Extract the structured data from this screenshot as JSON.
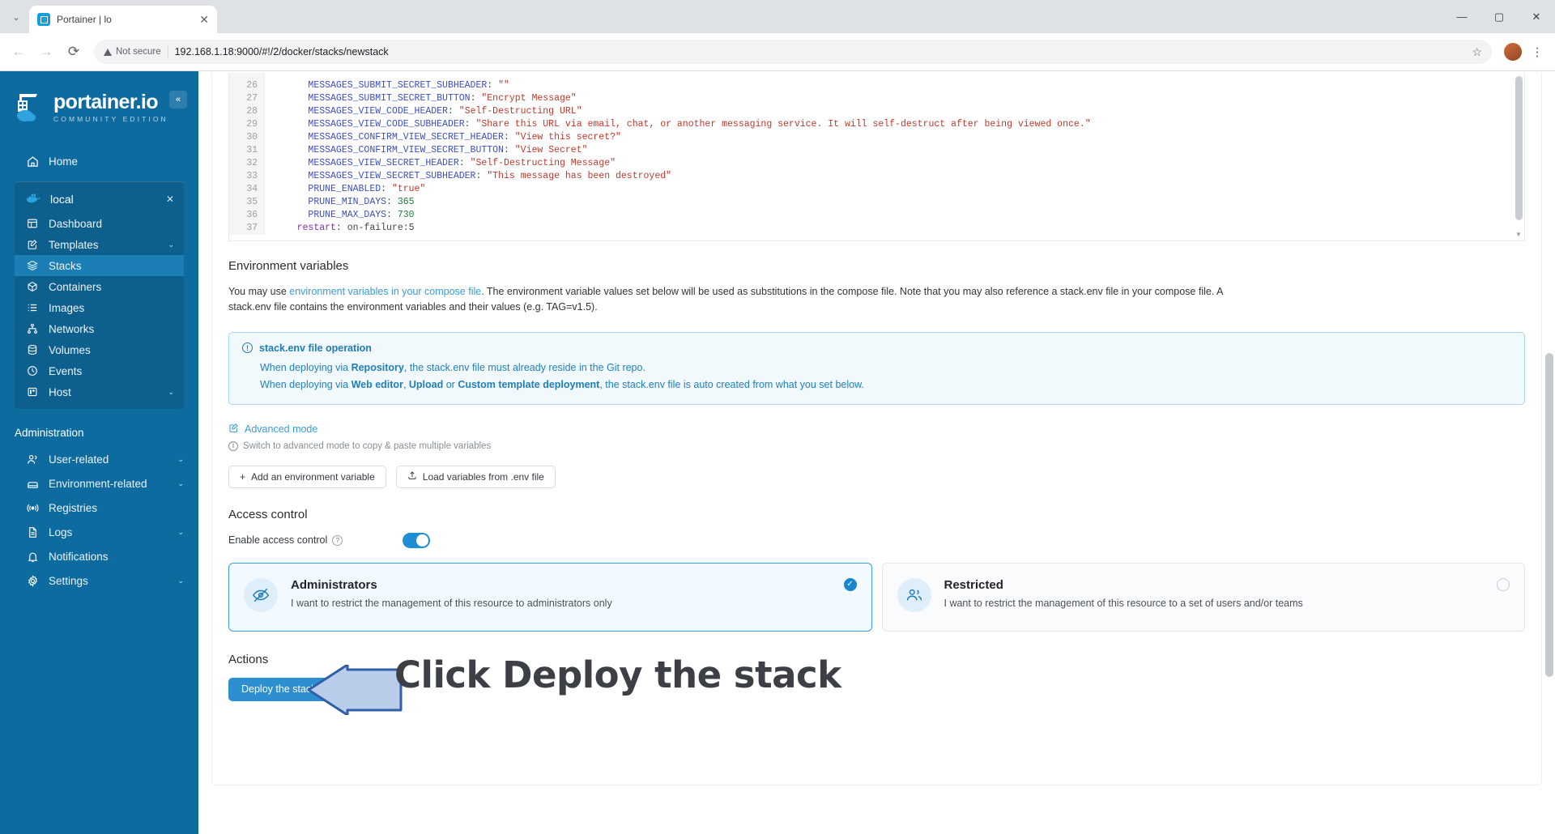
{
  "browser": {
    "tab": {
      "title": "Portainer | lo",
      "favicon": "portainer-favicon",
      "close": "✕"
    },
    "tab_list_chevron": "⌄",
    "window": {
      "minimize": "—",
      "maximize": "▢",
      "close": "✕"
    },
    "nav": {
      "back": "←",
      "forward": "→",
      "reload": "⟳"
    },
    "omnibox": {
      "security_label": "Not secure",
      "url": "192.168.1.18:9000/#!/2/docker/stacks/newstack",
      "star": "☆"
    },
    "menu": "⋮"
  },
  "sidebar": {
    "logo": {
      "name": "portainer.io",
      "edition": "COMMUNITY EDITION"
    },
    "collapse": "«",
    "home": {
      "label": "Home",
      "icon": "home-icon"
    },
    "environment": {
      "label": "local",
      "icon": "docker-icon",
      "close": "✕"
    },
    "env_items": [
      {
        "label": "Dashboard",
        "icon": "dashboard-icon",
        "chevron": "",
        "active": false
      },
      {
        "label": "Templates",
        "icon": "templates-icon",
        "chevron": "⌄",
        "active": false
      },
      {
        "label": "Stacks",
        "icon": "stacks-icon",
        "chevron": "",
        "active": true
      },
      {
        "label": "Containers",
        "icon": "containers-icon",
        "chevron": "",
        "active": false
      },
      {
        "label": "Images",
        "icon": "images-icon",
        "chevron": "",
        "active": false
      },
      {
        "label": "Networks",
        "icon": "networks-icon",
        "chevron": "",
        "active": false
      },
      {
        "label": "Volumes",
        "icon": "volumes-icon",
        "chevron": "",
        "active": false
      },
      {
        "label": "Events",
        "icon": "events-icon",
        "chevron": "",
        "active": false
      },
      {
        "label": "Host",
        "icon": "host-icon",
        "chevron": "⌄",
        "active": false
      }
    ],
    "admin_title": "Administration",
    "admin_items": [
      {
        "label": "User-related",
        "icon": "users-icon",
        "chevron": "⌄"
      },
      {
        "label": "Environment-related",
        "icon": "environment-icon",
        "chevron": "⌄"
      },
      {
        "label": "Registries",
        "icon": "registries-icon",
        "chevron": ""
      },
      {
        "label": "Logs",
        "icon": "logs-icon",
        "chevron": "⌄"
      },
      {
        "label": "Notifications",
        "icon": "notifications-icon",
        "chevron": ""
      },
      {
        "label": "Settings",
        "icon": "settings-icon",
        "chevron": "⌄"
      }
    ]
  },
  "editor": {
    "lines": [
      {
        "no": "26",
        "indent": 6,
        "key": "MESSAGES_SUBMIT_SECRET_SUBHEADER",
        "value": "\"\"",
        "vtype": "s"
      },
      {
        "no": "27",
        "indent": 6,
        "key": "MESSAGES_SUBMIT_SECRET_BUTTON",
        "value": "\"Encrypt Message\"",
        "vtype": "s"
      },
      {
        "no": "28",
        "indent": 6,
        "key": "MESSAGES_VIEW_CODE_HEADER",
        "value": "\"Self-Destructing URL\"",
        "vtype": "s"
      },
      {
        "no": "29",
        "indent": 6,
        "key": "MESSAGES_VIEW_CODE_SUBHEADER",
        "value": "\"Share this URL via email, chat, or another messaging service. It will self-destruct after being viewed once.\"",
        "vtype": "s"
      },
      {
        "no": "30",
        "indent": 6,
        "key": "MESSAGES_CONFIRM_VIEW_SECRET_HEADER",
        "value": "\"View this secret?\"",
        "vtype": "s"
      },
      {
        "no": "31",
        "indent": 6,
        "key": "MESSAGES_CONFIRM_VIEW_SECRET_BUTTON",
        "value": "\"View Secret\"",
        "vtype": "s"
      },
      {
        "no": "32",
        "indent": 6,
        "key": "MESSAGES_VIEW_SECRET_HEADER",
        "value": "\"Self-Destructing Message\"",
        "vtype": "s"
      },
      {
        "no": "33",
        "indent": 6,
        "key": "MESSAGES_VIEW_SECRET_SUBHEADER",
        "value": "\"This message has been destroyed\"",
        "vtype": "s"
      },
      {
        "no": "34",
        "indent": 6,
        "key": "PRUNE_ENABLED",
        "value": "\"true\"",
        "vtype": "s"
      },
      {
        "no": "35",
        "indent": 6,
        "key": "PRUNE_MIN_DAYS",
        "value": "365",
        "vtype": "n"
      },
      {
        "no": "36",
        "indent": 6,
        "key": "PRUNE_MAX_DAYS",
        "value": "730",
        "vtype": "n"
      },
      {
        "no": "37",
        "indent": 4,
        "key": "restart",
        "value": "on-failure:5",
        "vtype": "pl",
        "keytype": "p"
      }
    ],
    "scroll_up": "▲",
    "scroll_down": "▼"
  },
  "env_section": {
    "title": "Environment variables",
    "help_pre": "You may use ",
    "help_link": "environment variables in your compose file",
    "help_post": ". The environment variable values set below will be used as substitutions in the compose file. Note that you may also reference a stack.env file in your compose file. A stack.env file contains the environment variables and their values (e.g. TAG=v1.5).",
    "info": {
      "icon": "info-circle-icon",
      "title": "stack.env file operation",
      "row1_pre": "When deploying via ",
      "row1_b1": "Repository",
      "row1_post": ", the stack.env file must already reside in the Git repo.",
      "row2_pre": "When deploying via ",
      "row2_b1": "Web editor",
      "row2_mid1": ", ",
      "row2_b2": "Upload",
      "row2_mid2": " or ",
      "row2_b3": "Custom template deployment",
      "row2_post": ", the stack.env file is auto created from what you set below."
    },
    "advanced_mode": "Advanced mode",
    "advanced_note": "Switch to advanced mode to copy & paste multiple variables",
    "btn_add": "Add an environment variable",
    "btn_add_icon": "+",
    "btn_load": "Load variables from .env file",
    "btn_load_icon": "upload-icon"
  },
  "access_control": {
    "title": "Access control",
    "toggle_label": "Enable access control",
    "toggle_help": "?",
    "toggle_on": true,
    "cards": [
      {
        "title": "Administrators",
        "desc": "I want to restrict the management of this resource to administrators only",
        "icon": "eye-off-icon",
        "selected": true,
        "check": "✓"
      },
      {
        "title": "Restricted",
        "desc": "I want to restrict the management of this resource to a set of users and/or teams",
        "icon": "users-group-icon",
        "selected": false,
        "check": ""
      }
    ]
  },
  "actions": {
    "title": "Actions",
    "deploy_label": "Deploy the stack",
    "annotation": "Click Deploy the stack",
    "annotation_arrow": "left-arrow-annotation"
  },
  "colors": {
    "sidebar_bg": "#0e6ba0",
    "sidebar_env_bg": "#0d5f8e",
    "sidebar_active": "#1b7fb5",
    "accent": "#2e8fd0",
    "link": "#3a9bd9",
    "info_bg": "#f2f9fd",
    "info_border": "#a9d7ef",
    "card_selected_border": "#36a3e0",
    "annotation_fill": "#b9cdea",
    "annotation_stroke": "#2f5fa8"
  }
}
